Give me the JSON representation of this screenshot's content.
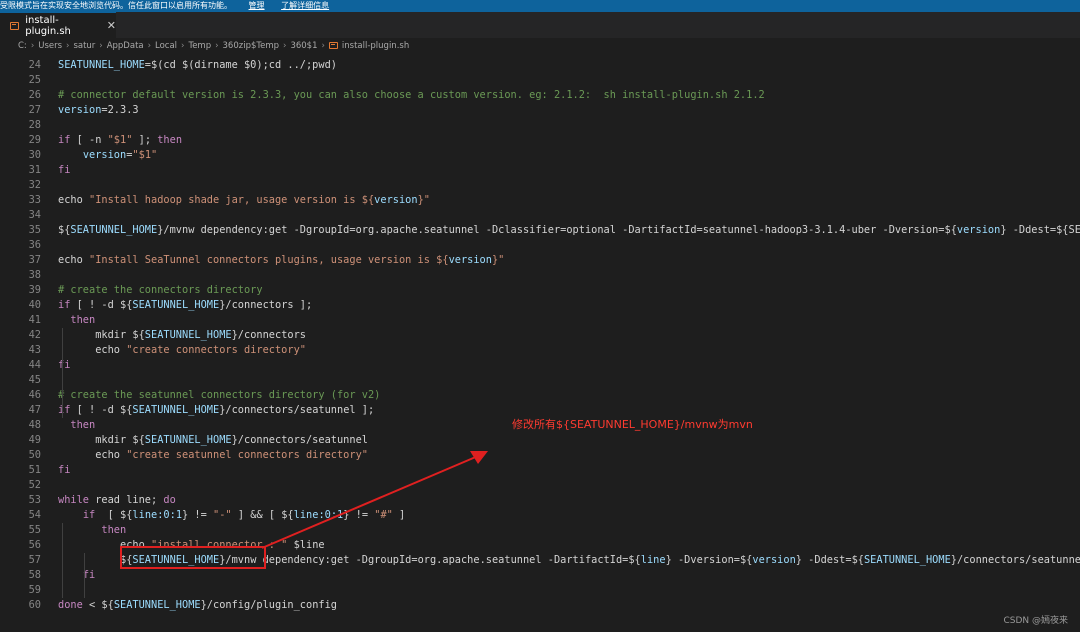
{
  "banner": {
    "message": "受限模式旨在实现安全地浏览代码。信任此窗口以启用所有功能。",
    "manage": "管理",
    "learn_more": "了解详细信息"
  },
  "tab": {
    "label": "install-plugin.sh",
    "close": "✕",
    "icon": "shell-file-icon"
  },
  "breadcrumb": {
    "segments": [
      "C:",
      "Users",
      "satur",
      "AppData",
      "Local",
      "Temp",
      "360zip$Temp",
      "360$1"
    ],
    "file": "install-plugin.sh"
  },
  "colors": {
    "text": "#d4d4d4",
    "var": "#9cdcfe",
    "kw": "#c586c0",
    "str": "#ce9178",
    "comment": "#6a9955",
    "num": "#b5cea8",
    "annotation": "#ff3b30"
  },
  "lines": [
    {
      "n": "24",
      "tokens": [
        [
          "var",
          "SEATUNNEL_HOME"
        ],
        [
          "text",
          "=$(cd $(dirname $0);cd ../;pwd)"
        ]
      ]
    },
    {
      "n": "25",
      "tokens": []
    },
    {
      "n": "26",
      "tokens": [
        [
          "comment",
          "# connector default version is 2.3.3, you can also choose a custom version. eg: 2.1.2:  sh install-plugin.sh 2.1.2"
        ]
      ]
    },
    {
      "n": "27",
      "tokens": [
        [
          "var",
          "version"
        ],
        [
          "text",
          "=2.3.3"
        ]
      ]
    },
    {
      "n": "28",
      "tokens": []
    },
    {
      "n": "29",
      "tokens": [
        [
          "kw",
          "if"
        ],
        [
          "text",
          " [ -n "
        ],
        [
          "str",
          "\"$1\""
        ],
        [
          "text",
          " ]; "
        ],
        [
          "kw",
          "then"
        ]
      ]
    },
    {
      "n": "30",
      "tokens": [
        [
          "text",
          "    "
        ],
        [
          "var",
          "version"
        ],
        [
          "text",
          "="
        ],
        [
          "str",
          "\"$1\""
        ]
      ]
    },
    {
      "n": "31",
      "tokens": [
        [
          "kw",
          "fi"
        ]
      ]
    },
    {
      "n": "32",
      "tokens": []
    },
    {
      "n": "33",
      "tokens": [
        [
          "text",
          "echo "
        ],
        [
          "str",
          "\"Install hadoop shade jar, usage version is ${"
        ],
        [
          "var",
          "version"
        ],
        [
          "str",
          "}\""
        ]
      ]
    },
    {
      "n": "34",
      "tokens": []
    },
    {
      "n": "35",
      "tokens": [
        [
          "text",
          "${"
        ],
        [
          "var",
          "SEATUNNEL_HOME"
        ],
        [
          "text",
          "}/mvnw dependency:get -DgroupId=org.apache.seatunnel -Dclassifier=optional -DartifactId=seatunnel-hadoop3-3.1.4-uber -Dversion=${"
        ],
        [
          "var",
          "version"
        ],
        [
          "text",
          "} -Ddest=${SEATUNNEL_HOME}"
        ]
      ]
    },
    {
      "n": "36",
      "tokens": []
    },
    {
      "n": "37",
      "tokens": [
        [
          "text",
          "echo "
        ],
        [
          "str",
          "\"Install SeaTunnel connectors plugins, usage version is ${"
        ],
        [
          "var",
          "version"
        ],
        [
          "str",
          "}\""
        ]
      ]
    },
    {
      "n": "38",
      "tokens": []
    },
    {
      "n": "39",
      "tokens": [
        [
          "comment",
          "# create the connectors directory"
        ]
      ]
    },
    {
      "n": "40",
      "tokens": [
        [
          "kw",
          "if"
        ],
        [
          "text",
          " [ ! -d ${"
        ],
        [
          "var",
          "SEATUNNEL_HOME"
        ],
        [
          "text",
          "}/connectors ];"
        ]
      ]
    },
    {
      "n": "41",
      "tokens": [
        [
          "text",
          "  "
        ],
        [
          "kw",
          "then"
        ]
      ]
    },
    {
      "n": "42",
      "tokens": [
        [
          "text",
          "      mkdir ${"
        ],
        [
          "var",
          "SEATUNNEL_HOME"
        ],
        [
          "text",
          "}/connectors"
        ]
      ]
    },
    {
      "n": "43",
      "tokens": [
        [
          "text",
          "      echo "
        ],
        [
          "str",
          "\"create connectors directory\""
        ]
      ]
    },
    {
      "n": "44",
      "tokens": [
        [
          "kw",
          "fi"
        ]
      ]
    },
    {
      "n": "45",
      "tokens": []
    },
    {
      "n": "46",
      "tokens": [
        [
          "comment",
          "# create the seatunnel connectors directory (for v2)"
        ]
      ]
    },
    {
      "n": "47",
      "tokens": [
        [
          "kw",
          "if"
        ],
        [
          "text",
          " [ ! -d ${"
        ],
        [
          "var",
          "SEATUNNEL_HOME"
        ],
        [
          "text",
          "}/connectors/seatunnel ];"
        ]
      ]
    },
    {
      "n": "48",
      "tokens": [
        [
          "text",
          "  "
        ],
        [
          "kw",
          "then"
        ]
      ]
    },
    {
      "n": "49",
      "tokens": [
        [
          "text",
          "      mkdir ${"
        ],
        [
          "var",
          "SEATUNNEL_HOME"
        ],
        [
          "text",
          "}/connectors/seatunnel"
        ]
      ]
    },
    {
      "n": "50",
      "tokens": [
        [
          "text",
          "      echo "
        ],
        [
          "str",
          "\"create seatunnel connectors directory\""
        ]
      ]
    },
    {
      "n": "51",
      "tokens": [
        [
          "kw",
          "fi"
        ]
      ]
    },
    {
      "n": "52",
      "tokens": []
    },
    {
      "n": "53",
      "tokens": [
        [
          "kw",
          "while"
        ],
        [
          "text",
          " read line; "
        ],
        [
          "kw",
          "do"
        ]
      ]
    },
    {
      "n": "54",
      "tokens": [
        [
          "text",
          "    "
        ],
        [
          "kw",
          "if"
        ],
        [
          "text",
          "  [ ${"
        ],
        [
          "var",
          "line:0:1"
        ],
        [
          "text",
          "} != "
        ],
        [
          "str",
          "\"-\""
        ],
        [
          "text",
          " ] && [ ${"
        ],
        [
          "var",
          "line:0:1"
        ],
        [
          "text",
          "} != "
        ],
        [
          "str",
          "\"#\""
        ],
        [
          "text",
          " ]"
        ]
      ]
    },
    {
      "n": "55",
      "tokens": [
        [
          "text",
          "       "
        ],
        [
          "kw",
          "then"
        ]
      ]
    },
    {
      "n": "56",
      "tokens": [
        [
          "text",
          "          echo "
        ],
        [
          "str",
          "\"install connector : \""
        ],
        [
          "text",
          " $line"
        ]
      ]
    },
    {
      "n": "57",
      "tokens": [
        [
          "text",
          "          ${"
        ],
        [
          "var",
          "SEATUNNEL_HOME"
        ],
        [
          "text",
          "}/mvnw dependency:get -DgroupId=org.apache.seatunnel -DartifactId=${"
        ],
        [
          "var",
          "line"
        ],
        [
          "text",
          "} -Dversion=${"
        ],
        [
          "var",
          "version"
        ],
        [
          "text",
          "} -Ddest=${"
        ],
        [
          "var",
          "SEATUNNEL_HOME"
        ],
        [
          "text",
          "}/connectors/seatunnel"
        ]
      ]
    },
    {
      "n": "58",
      "tokens": [
        [
          "text",
          "    "
        ],
        [
          "kw",
          "fi"
        ]
      ]
    },
    {
      "n": "59",
      "tokens": []
    },
    {
      "n": "60",
      "tokens": [
        [
          "kw",
          "done"
        ],
        [
          "text",
          " < ${"
        ],
        [
          "var",
          "SEATUNNEL_HOME"
        ],
        [
          "text",
          "}/config/plugin_config"
        ]
      ]
    }
  ],
  "annotation": {
    "text": "修改所有${SEATUNNEL_HOME}/mvnw为mvn"
  },
  "watermark": "CSDN @嫣夜来"
}
